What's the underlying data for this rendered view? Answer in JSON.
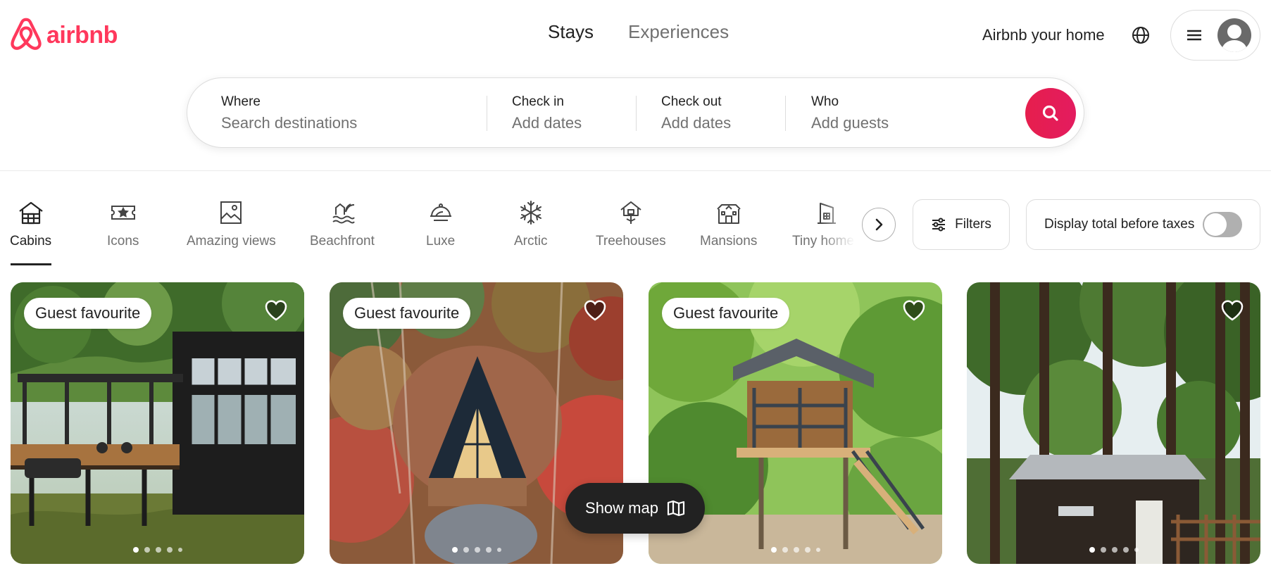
{
  "header": {
    "logo_text": "airbnb",
    "logo_color": "#FF385C",
    "tabs": [
      {
        "label": "Stays",
        "active": true
      },
      {
        "label": "Experiences",
        "active": false
      }
    ],
    "host_link": "Airbnb your home",
    "globe_icon": "globe-icon",
    "menu_icon": "hamburger-icon",
    "avatar_icon": "user-avatar-icon"
  },
  "search": {
    "where_label": "Where",
    "where_placeholder": "Search destinations",
    "checkin_label": "Check in",
    "checkin_value": "Add dates",
    "checkout_label": "Check out",
    "checkout_value": "Add dates",
    "who_label": "Who",
    "who_value": "Add guests",
    "button_color": "#E61E4D",
    "button_icon": "search-icon"
  },
  "categories": {
    "items": [
      {
        "label": "Cabins",
        "icon": "cabin-icon",
        "active": true
      },
      {
        "label": "Icons",
        "icon": "ticket-icon",
        "active": false
      },
      {
        "label": "Amazing views",
        "icon": "landscape-icon",
        "active": false
      },
      {
        "label": "Beachfront",
        "icon": "beach-icon",
        "active": false
      },
      {
        "label": "Luxe",
        "icon": "cloche-icon",
        "active": false
      },
      {
        "label": "Arctic",
        "icon": "snowflake-icon",
        "active": false
      },
      {
        "label": "Treehouses",
        "icon": "treehouse-icon",
        "active": false
      },
      {
        "label": "Mansions",
        "icon": "mansion-icon",
        "active": false
      },
      {
        "label": "Tiny homes",
        "icon": "tiny-home-icon",
        "active": false
      }
    ],
    "next_icon": "chevron-right-icon",
    "filters_label": "Filters",
    "filters_icon": "sliders-icon",
    "taxes_label": "Display total before taxes",
    "taxes_enabled": false
  },
  "listings": [
    {
      "badge": "Guest favourite",
      "favorited": false,
      "photo_count": 5,
      "active_photo": 1
    },
    {
      "badge": "Guest favourite",
      "favorited": false,
      "photo_count": 5,
      "active_photo": 1
    },
    {
      "badge": "Guest favourite",
      "favorited": false,
      "photo_count": 5,
      "active_photo": 1
    },
    {
      "badge": "",
      "favorited": false,
      "photo_count": 5,
      "active_photo": 1
    }
  ],
  "show_map": {
    "label": "Show map",
    "icon": "map-icon"
  }
}
